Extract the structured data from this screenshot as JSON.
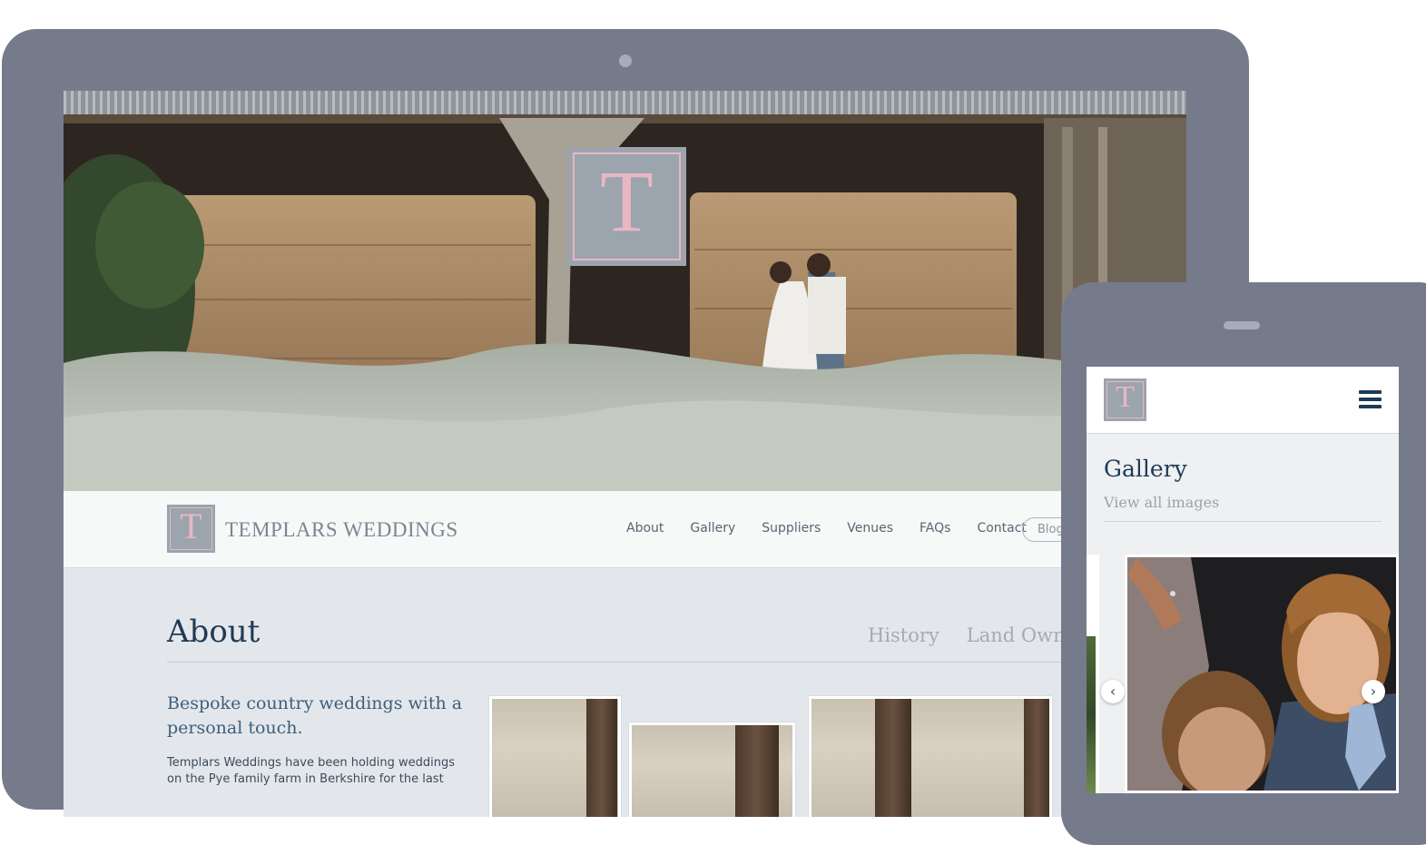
{
  "desktop": {
    "hero": {
      "logo_letter": "T"
    },
    "nav": {
      "brand_letter": "T",
      "brand_name": "TEMPLARS WEDDINGS",
      "links": [
        "About",
        "Gallery",
        "Suppliers",
        "Venues",
        "FAQs",
        "Contact"
      ],
      "blog": "Blog"
    },
    "about": {
      "title": "About",
      "tabs": [
        "History",
        "Land Owners"
      ],
      "lead": "Bespoke country weddings with a personal touch.",
      "body": "Templars Weddings have been holding weddings on the Pye family farm in Berkshire for the last"
    }
  },
  "phone": {
    "logo_letter": "T",
    "menu_icon": "hamburger-menu-icon",
    "gallery_title": "Gallery",
    "gallery_link": "View all images",
    "prev_arrow": "‹",
    "next_arrow": "›"
  },
  "colors": {
    "device_frame": "#757b8b",
    "brand_grey": "#9ca4ad",
    "brand_pink": "#e9b7c3",
    "heading_navy": "#1f3a55"
  }
}
